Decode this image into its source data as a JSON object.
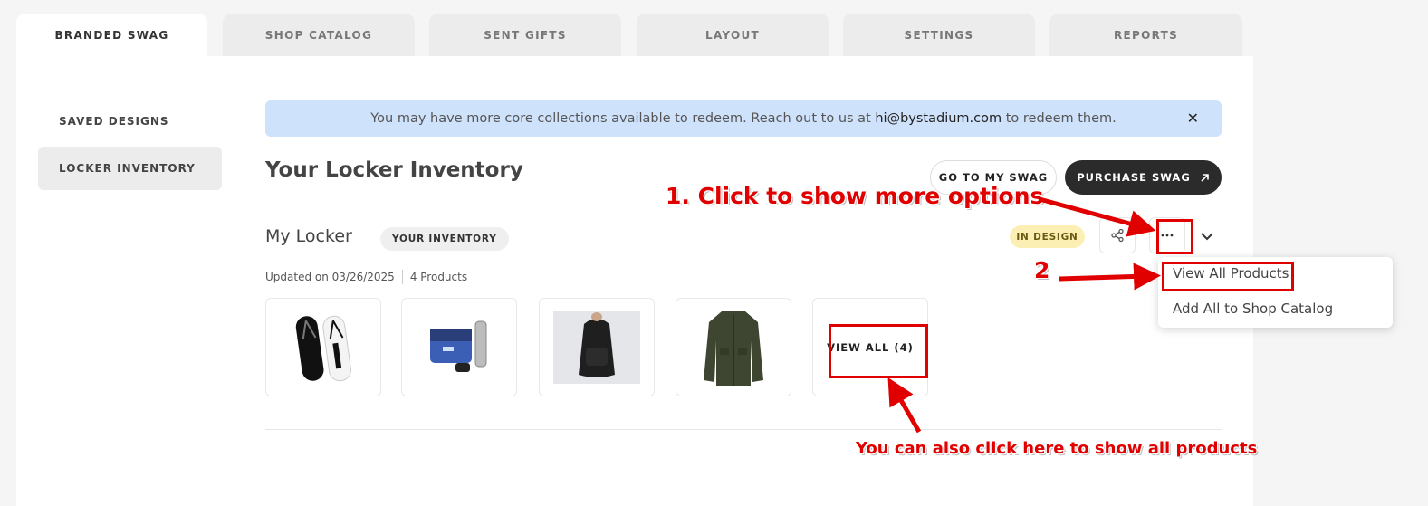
{
  "tabs": [
    "BRANDED SWAG",
    "SHOP CATALOG",
    "SENT GIFTS",
    "LAYOUT",
    "SETTINGS",
    "REPORTS"
  ],
  "sidebar": {
    "items": [
      "SAVED DESIGNS",
      "LOCKER INVENTORY"
    ]
  },
  "banner": {
    "text_before": "You may have more core collections available to redeem. Reach out to us at",
    "email": "hi@bystadium.com",
    "text_after": "to redeem them.",
    "close": "✕"
  },
  "page": {
    "title": "Your Locker Inventory"
  },
  "header_buttons": {
    "go_to_swag": "GO TO MY SWAG",
    "purchase_swag": "PURCHASE SWAG"
  },
  "locker": {
    "title": "My Locker",
    "pill": "YOUR INVENTORY",
    "status": "IN DESIGN",
    "updated": "Updated on 03/26/2025",
    "products_count": "4 Products",
    "view_all": "VIEW ALL (4)",
    "products": [
      "flip-flops",
      "messenger-bag-bottle-kit",
      "backpack",
      "jacket"
    ]
  },
  "menu": {
    "items": [
      "View All Products",
      "Add All to Shop Catalog"
    ]
  },
  "annotations": {
    "step1": "1. Click to show more options",
    "step2": "2",
    "alt": "You can also click here to show all products"
  },
  "colors": {
    "annotation_red": "#e00000",
    "banner_blue": "#cfe2fb",
    "status_yellow": "#fcefb4"
  }
}
